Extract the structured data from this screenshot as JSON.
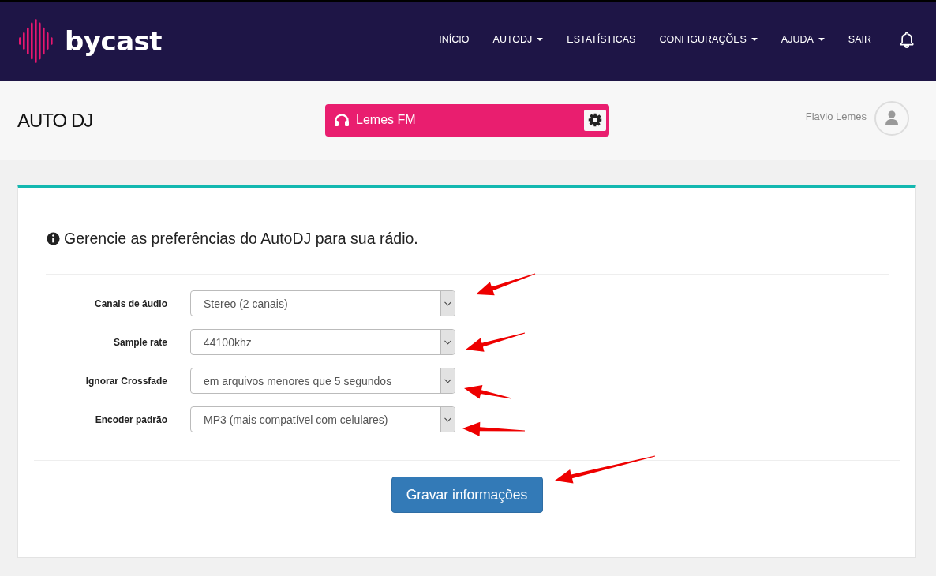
{
  "brand": {
    "name": "bycast"
  },
  "nav": [
    {
      "label": "INÍCIO",
      "dropdown": false
    },
    {
      "label": "AUTODJ",
      "dropdown": true
    },
    {
      "label": "ESTATÍSTICAS",
      "dropdown": false
    },
    {
      "label": "CONFIGURAÇÕES",
      "dropdown": true
    },
    {
      "label": "AJUDA",
      "dropdown": true
    },
    {
      "label": "SAIR",
      "dropdown": false
    }
  ],
  "page_title": "AUTO DJ",
  "station": {
    "name": "Lemes FM"
  },
  "user": {
    "name": "Flavio Lemes"
  },
  "intro": "Gerencie as preferências do AutoDJ para sua rádio.",
  "fields": [
    {
      "label": "Canais de áudio",
      "value": "Stereo (2 canais)"
    },
    {
      "label": "Sample rate",
      "value": "44100khz"
    },
    {
      "label": "Ignorar Crossfade",
      "value": "em arquivos menores que 5 segundos"
    },
    {
      "label": "Encoder padrão",
      "value": "MP3 (mais compatível com celulares)"
    }
  ],
  "submit": "Gravar informações"
}
